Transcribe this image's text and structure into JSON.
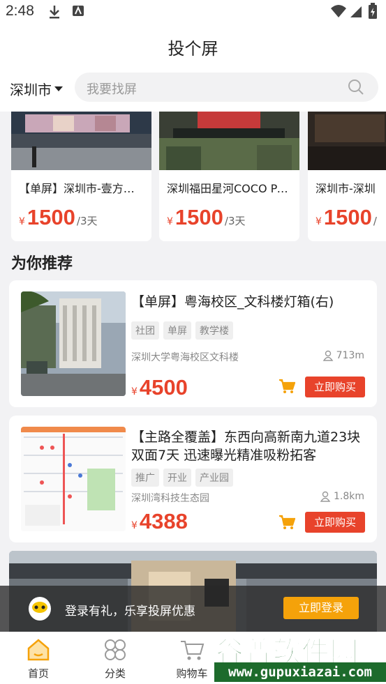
{
  "status_bar": {
    "time": "2:48"
  },
  "header": {
    "title": "投个屏"
  },
  "search": {
    "city": "深圳市",
    "placeholder": "我要找屏"
  },
  "featured": [
    {
      "name": "【单屏】深圳市-壹方…",
      "currency": "¥",
      "price": "1500",
      "unit": "/3天"
    },
    {
      "name": "深圳福田星河COCO Pa…",
      "currency": "¥",
      "price": "1500",
      "unit": "/3天"
    },
    {
      "name": "深圳市-深圳",
      "currency": "¥",
      "price": "1500",
      "unit": "/"
    }
  ],
  "recommend": {
    "title": "为你推荐",
    "items": [
      {
        "title": "【单屏】粤海校区_文科楼灯箱(右)",
        "tags": [
          "社团",
          "单屏",
          "教学楼"
        ],
        "location": "深圳大学粤海校区文科楼",
        "distance": "713m",
        "currency": "¥",
        "price": "4500",
        "buy_label": "立即购买"
      },
      {
        "title": "【主路全覆盖】东西向高新南九道23块双面7天 迅速曝光精准吸粉拓客",
        "tags": [
          "推广",
          "开业",
          "产业园"
        ],
        "location": "深圳湾科技生态园",
        "distance": "1.8km",
        "currency": "¥",
        "price": "4388",
        "buy_label": "立即购买"
      }
    ]
  },
  "login_prompt": {
    "text": "登录有礼，乐享投屏优惠",
    "button": "立即登录"
  },
  "tabs": [
    {
      "label": "首页",
      "icon": "home-icon",
      "active": true
    },
    {
      "label": "分类",
      "icon": "category-icon",
      "active": false
    },
    {
      "label": "购物车",
      "icon": "cart-icon",
      "active": false
    }
  ],
  "watermark": {
    "title": "谷普软件园",
    "url": "www.gupuxiazai.com"
  },
  "colors": {
    "accent": "#e8432b",
    "login_button": "#f5a20a",
    "watermark": "#1d6b2c"
  }
}
